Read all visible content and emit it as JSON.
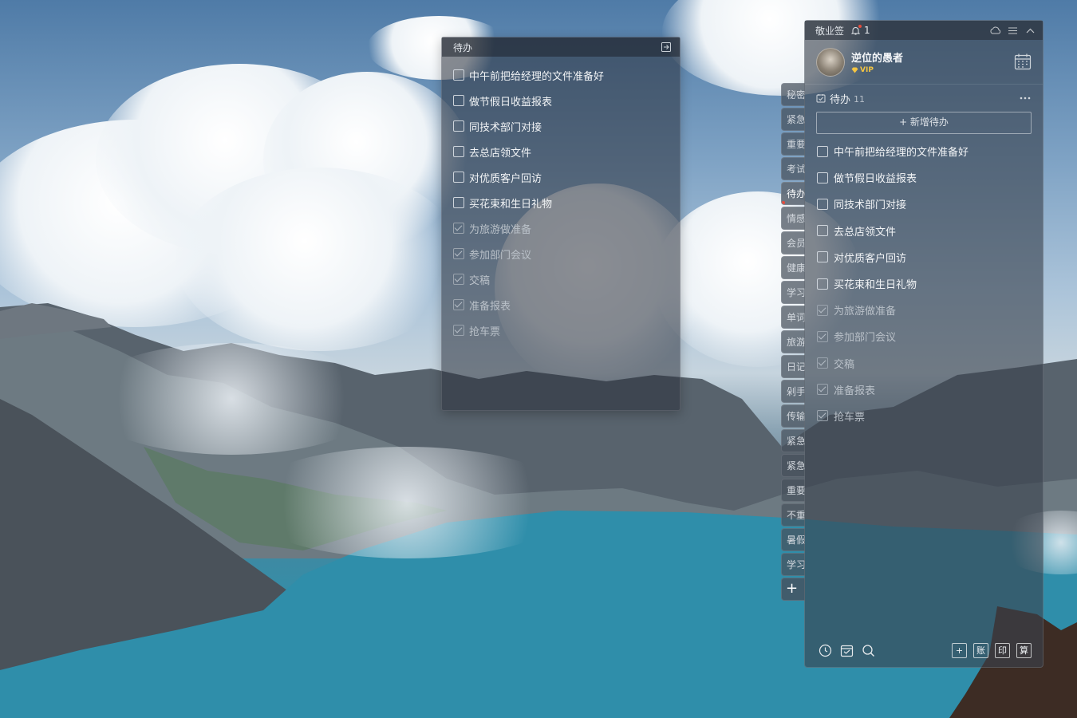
{
  "note": {
    "title": "待办",
    "tasks": [
      {
        "label": "中午前把给经理的文件准备好",
        "done": false
      },
      {
        "label": "做节假日收益报表",
        "done": false
      },
      {
        "label": "同技术部门对接",
        "done": false
      },
      {
        "label": "去总店领文件",
        "done": false
      },
      {
        "label": "对优质客户回访",
        "done": false
      },
      {
        "label": "买花束和生日礼物",
        "done": false
      },
      {
        "label": "为旅游做准备",
        "done": true
      },
      {
        "label": "参加部门会议",
        "done": true
      },
      {
        "label": "交稿",
        "done": true
      },
      {
        "label": "准备报表",
        "done": true
      },
      {
        "label": "抢车票",
        "done": true
      }
    ]
  },
  "tabs": [
    "秘密",
    "紧急",
    "重要",
    "考试",
    "待办",
    "情感",
    "会员",
    "健康",
    "学习",
    "单词",
    "旅游",
    "日记",
    "剁手",
    "传输",
    "紧急",
    "紧急",
    "重要",
    "不重",
    "暑假",
    "学习"
  ],
  "active_tab": "待办",
  "tab_add_label": "+",
  "panel": {
    "app_name": "敬业签",
    "notification_count": "1",
    "user": {
      "name": "逆位的愚者",
      "vip": "VIP"
    },
    "section": {
      "title": "待办",
      "count": "11",
      "add_label": "+ 新增待办"
    },
    "footer_buttons": [
      "+",
      "账",
      "印",
      "算"
    ]
  },
  "colors": {
    "accent_red": "#e74c3c",
    "vip_gold": "#f4c542"
  }
}
